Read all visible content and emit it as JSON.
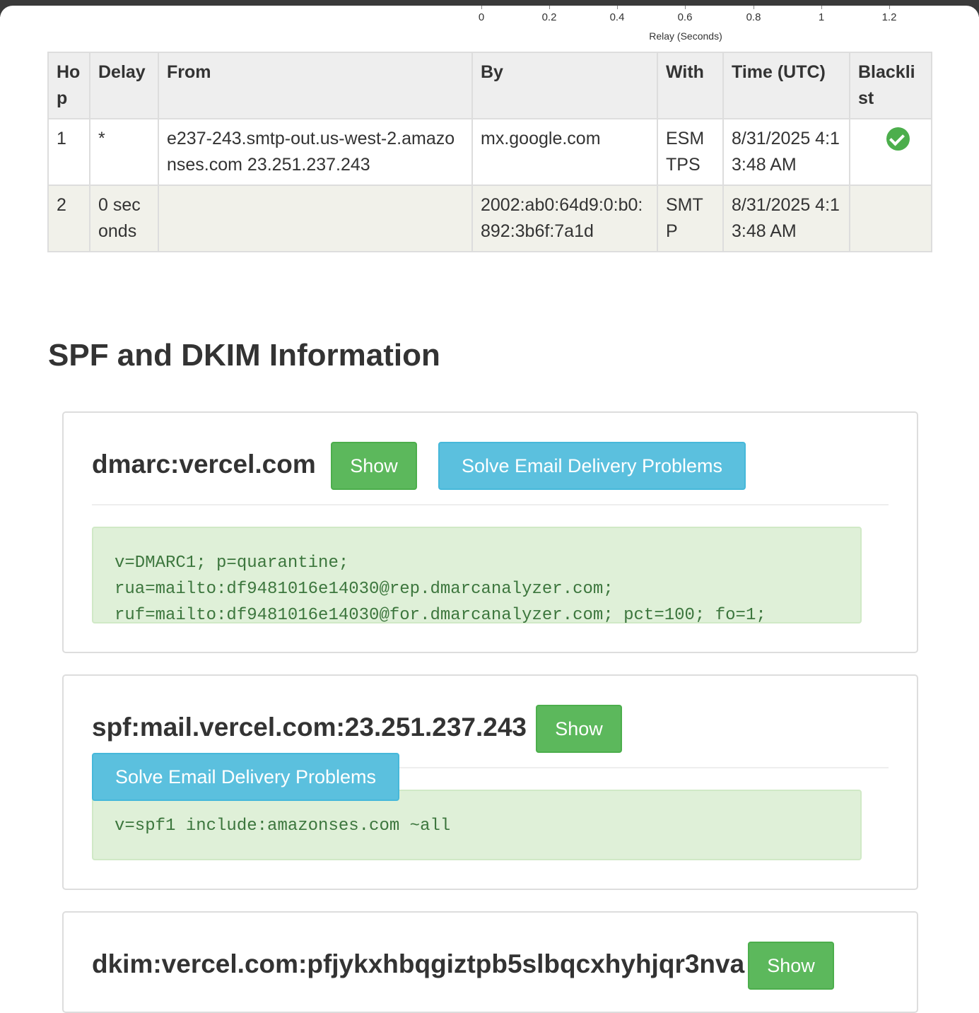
{
  "chart": {
    "ticks": [
      "0",
      "0.2",
      "0.4",
      "0.6",
      "0.8",
      "1",
      "1.2"
    ],
    "xlabel": "Relay (Seconds)"
  },
  "table": {
    "headers": [
      "Hop",
      "Delay",
      "From",
      "By",
      "With",
      "Time (UTC)",
      "Blacklist"
    ],
    "rows": [
      {
        "hop": "1",
        "delay": "*",
        "from": "e237-243.smtp-out.us-west-2.amazonses.com 23.251.237.243",
        "by": "mx.google.com",
        "with": "ESMTPS",
        "time": "8/31/2025 4:13:48 AM",
        "blacklist_icon": "check-circle-icon"
      },
      {
        "hop": "2",
        "delay": "0 seconds",
        "from": "",
        "by": "2002:ab0:64d9:0:b0:892:3b6f:7a1d",
        "with": "SMTP",
        "time": "8/31/2025 4:13:48 AM",
        "blacklist_icon": ""
      }
    ]
  },
  "section_title": "SPF and DKIM Information",
  "records": [
    {
      "title": "dmarc:vercel.com",
      "show_label": "Show",
      "solve_label": "Solve Email Delivery Problems",
      "value": "v=DMARC1; p=quarantine; rua=mailto:df9481016e14030@rep.dmarcanalyzer.com; ruf=mailto:df9481016e14030@for.dmarcanalyzer.com; pct=100; fo=1;"
    },
    {
      "title": "spf:mail.vercel.com:23.251.237.243",
      "show_label": "Show",
      "solve_label": "Solve Email Delivery Problems",
      "value": "v=spf1 include:amazonses.com ~all"
    },
    {
      "title": "dkim:vercel.com:pfjykxhbqgiztpb5slbqcxhyhjqr3nva",
      "show_label": "Show"
    }
  ],
  "colors": {
    "show": "#5cb85c",
    "solve": "#5bc0de",
    "record_bg": "#dff0d8",
    "record_text": "#3c763d",
    "check": "#4cae4c"
  }
}
